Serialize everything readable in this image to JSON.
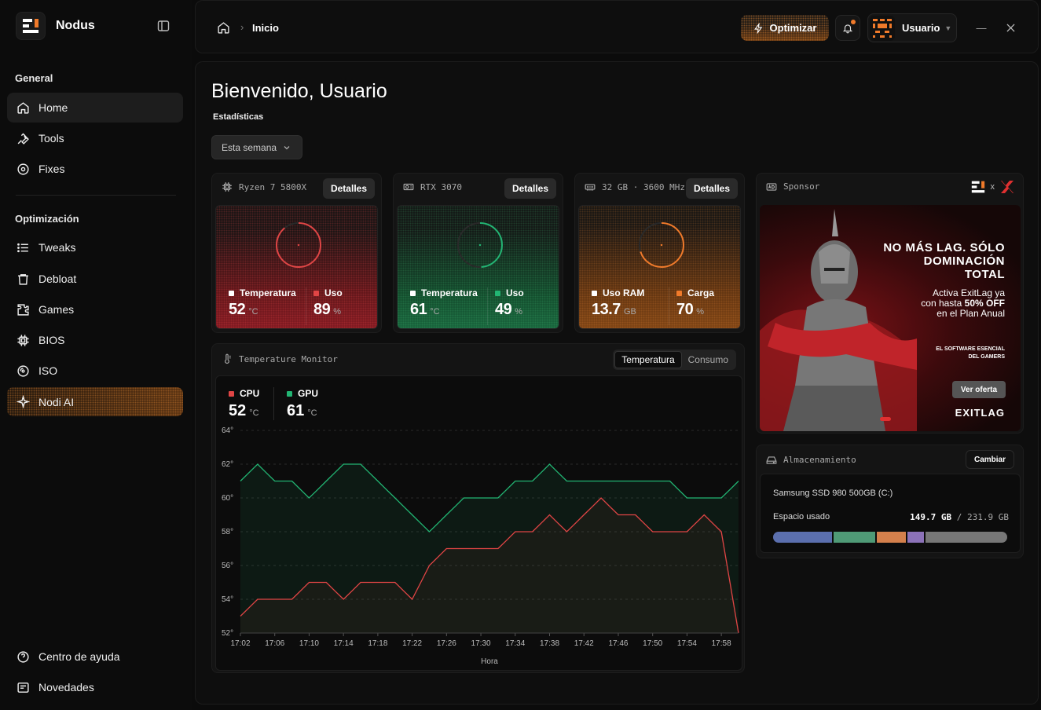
{
  "app": {
    "name": "Nodus"
  },
  "sidebar": {
    "general_title": "General",
    "optimizacion_title": "Optimización",
    "items": [
      {
        "label": "Home",
        "icon": "home-icon"
      },
      {
        "label": "Tools",
        "icon": "wrench-icon"
      },
      {
        "label": "Fixes",
        "icon": "fix-icon"
      },
      {
        "label": "Tweaks",
        "icon": "list-icon"
      },
      {
        "label": "Debloat",
        "icon": "trash-icon"
      },
      {
        "label": "Games",
        "icon": "puzzle-icon"
      },
      {
        "label": "BIOS",
        "icon": "chip-icon"
      },
      {
        "label": "ISO",
        "icon": "disc-icon"
      },
      {
        "label": "Nodi AI",
        "icon": "sparkle-icon"
      }
    ],
    "footer": [
      {
        "label": "Centro de ayuda",
        "icon": "help-icon"
      },
      {
        "label": "Novedades",
        "icon": "news-icon"
      }
    ]
  },
  "header": {
    "breadcrumb": "Inicio",
    "separator": "›",
    "optimize_label": "Optimizar",
    "user_label": "Usuario",
    "user_caret": "▼",
    "minimize": "—"
  },
  "main": {
    "title": "Bienvenido, Usuario",
    "subtitle": "Estadísticas",
    "period": "Esta semana",
    "cards": {
      "cpu": {
        "name": "Ryzen 7 5800X",
        "details": "Detalles",
        "k1": "Temperatura",
        "v1": "52",
        "u1": "°C",
        "k2": "Uso",
        "v2": "89",
        "u2": "%",
        "ring": 0.89
      },
      "gpu": {
        "name": "RTX 3070",
        "details": "Detalles",
        "k1": "Temperatura",
        "v1": "61",
        "u1": "°C",
        "k2": "Uso",
        "v2": "49",
        "u2": "%",
        "ring": 0.49
      },
      "ram": {
        "name": "32 GB · 3600 MHz",
        "details": "Detalles",
        "k1": "Uso RAM",
        "v1": "13.7",
        "u1": "GB",
        "k2": "Carga",
        "v2": "70",
        "u2": "%",
        "ring": 0.7
      }
    },
    "colors": {
      "red": "#e04545",
      "green": "#22b573",
      "orange": "#f07a2a"
    },
    "monitor": {
      "title": "Temperature Monitor",
      "tab_temp": "Temperatura",
      "tab_power": "Consumo",
      "cpu_label": "CPU",
      "cpu_value": "52",
      "cpu_unit": "°C",
      "gpu_label": "GPU",
      "gpu_value": "61",
      "gpu_unit": "°C"
    },
    "sponsor": {
      "title": "Sponsor",
      "x": "x",
      "headline_1": "NO MÁS LAG. SÓLO",
      "headline_2": "DOMINACIÓN",
      "headline_3": "TOTAL",
      "promo_1": "Activa ExitLag ya",
      "promo_2a": "con hasta ",
      "promo_2b": "50% OFF",
      "promo_3": "en el Plan Anual",
      "small_1": "EL SOFTWARE ESENCIAL",
      "small_2": "DEL GAMERS",
      "cta": "Ver oferta",
      "brand": "EXITLAG"
    },
    "storage": {
      "title": "Almacenamiento",
      "change": "Cambiar",
      "drive": "Samsung SSD 980 500GB (C:)",
      "used_label": "Espacio usado",
      "used": "149.7 GB",
      "sep": "/",
      "total": "231.9 GB",
      "segments": [
        {
          "fraction": 0.26,
          "color": "#5b6fae"
        },
        {
          "fraction": 0.18,
          "color": "#4f9a76"
        },
        {
          "fraction": 0.13,
          "color": "#d4804c"
        },
        {
          "fraction": 0.07,
          "color": "#8c72b8"
        },
        {
          "fraction": 0.36,
          "color": "#777777"
        }
      ]
    }
  },
  "chart_data": {
    "type": "area",
    "xlabel": "Hora",
    "ylim": [
      52,
      64
    ],
    "yticks": [
      "52°",
      "54°",
      "56°",
      "58°",
      "60°",
      "62°",
      "64°"
    ],
    "x": [
      "17:02",
      "17:03",
      "17:04",
      "17:05",
      "17:06",
      "17:07",
      "17:08",
      "17:09",
      "17:10",
      "17:11",
      "17:12",
      "17:13",
      "17:14",
      "17:15",
      "17:16",
      "17:17",
      "17:18",
      "17:19",
      "17:20",
      "17:21",
      "17:22",
      "17:23",
      "17:24",
      "17:25",
      "17:26",
      "17:27",
      "17:28",
      "17:29",
      "17:30",
      "17:31",
      "17:32",
      "17:33",
      "17:34",
      "17:35",
      "17:36",
      "17:37",
      "17:38",
      "17:39",
      "17:40",
      "17:41",
      "17:42",
      "17:43",
      "17:44",
      "17:45",
      "17:46",
      "17:47",
      "17:48",
      "17:49",
      "17:50",
      "17:51",
      "17:52",
      "17:53",
      "17:54",
      "17:55",
      "17:56",
      "17:57",
      "17:58",
      "17:59",
      "18:00"
    ],
    "xticks": [
      "17:02",
      "17:06",
      "17:10",
      "17:14",
      "17:18",
      "17:22",
      "17:26",
      "17:30",
      "17:34",
      "17:38",
      "17:42",
      "17:46",
      "17:50",
      "17:54",
      "17:58"
    ],
    "series": [
      {
        "name": "GPU",
        "color": "#22b573",
        "values": [
          61,
          61.5,
          62,
          61.5,
          61,
          61,
          61,
          60.5,
          60,
          60.5,
          61,
          61.5,
          62,
          62,
          62,
          61.5,
          61,
          60.5,
          60,
          59.5,
          59,
          58.5,
          58,
          58.5,
          59,
          59.5,
          60,
          60,
          60,
          60,
          60,
          60.5,
          61,
          61,
          61,
          61.5,
          62,
          61.5,
          61,
          61,
          61,
          61,
          61,
          61,
          61,
          61,
          61,
          61,
          61,
          61,
          61,
          60.5,
          60,
          60,
          60,
          60,
          60,
          60.5,
          61
        ]
      },
      {
        "name": "CPU",
        "color": "#e04545",
        "values": [
          53,
          53.5,
          54,
          54,
          54,
          54,
          54,
          54.5,
          55,
          55,
          55,
          54.5,
          54,
          54.5,
          55,
          55,
          55,
          55,
          55,
          54.5,
          54,
          55,
          56,
          56.5,
          57,
          57,
          57,
          57,
          57,
          57,
          57,
          57.5,
          58,
          58,
          58,
          58.5,
          59,
          58.5,
          58,
          58.5,
          59,
          59.5,
          60,
          59.5,
          59,
          59,
          59,
          58.5,
          58,
          58,
          58,
          58,
          58,
          58.5,
          59,
          58.5,
          58,
          55,
          52
        ]
      }
    ]
  }
}
